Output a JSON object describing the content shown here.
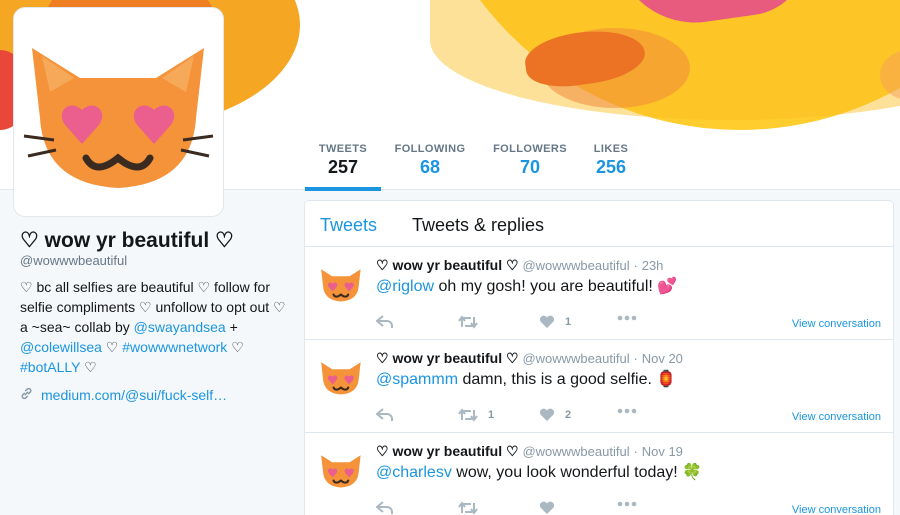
{
  "profile": {
    "name": "♡ wow yr beautiful ♡",
    "handle": "@wowwwbeautiful",
    "bio_parts": {
      "p1": "♡ bc all selfies are beautiful ♡ follow for selfie compliments ♡ unfollow to opt out ♡ a ~sea~ collab by ",
      "m1": "@swayandsea",
      "p2": " + ",
      "m2": "@colewillsea",
      "p3": " ♡ ",
      "h1": "#wowwwnetwork",
      "p4": " ♡ ",
      "h2": "#botALLY",
      "p5": " ♡"
    },
    "link": "medium.com/@sui/fuck-self…",
    "link_icon": "link-icon"
  },
  "stats": [
    {
      "label": "TWEETS",
      "value": "257"
    },
    {
      "label": "FOLLOWING",
      "value": "68"
    },
    {
      "label": "FOLLOWERS",
      "value": "70"
    },
    {
      "label": "LIKES",
      "value": "256"
    }
  ],
  "timeline": {
    "tabs": [
      "Tweets",
      "Tweets & replies"
    ],
    "view_conversation": "View conversation",
    "tweets": [
      {
        "name": "♡ wow yr beautiful ♡",
        "handle": "@wowwwbeautiful",
        "sep": "·",
        "time": "23h",
        "mention": "@riglow",
        "text": " oh my gosh! you are beautiful! ",
        "emoji": "💕",
        "retweets": "",
        "likes": "1"
      },
      {
        "name": "♡ wow yr beautiful ♡",
        "handle": "@wowwwbeautiful",
        "sep": "·",
        "time": "Nov 20",
        "mention": "@spammm",
        "text": " damn, this is a good selfie. ",
        "emoji": "🏮",
        "retweets": "1",
        "likes": "2"
      },
      {
        "name": "♡ wow yr beautiful ♡",
        "handle": "@wowwwbeautiful",
        "sep": "·",
        "time": "Nov 19",
        "mention": "@charlesv",
        "text": " wow, you look wonderful today! ",
        "emoji": "🍀",
        "retweets": "",
        "likes": ""
      }
    ]
  },
  "colors": {
    "accent": "#1b95e0",
    "cat": "#f4933a",
    "heart": "#ea5f8d"
  }
}
